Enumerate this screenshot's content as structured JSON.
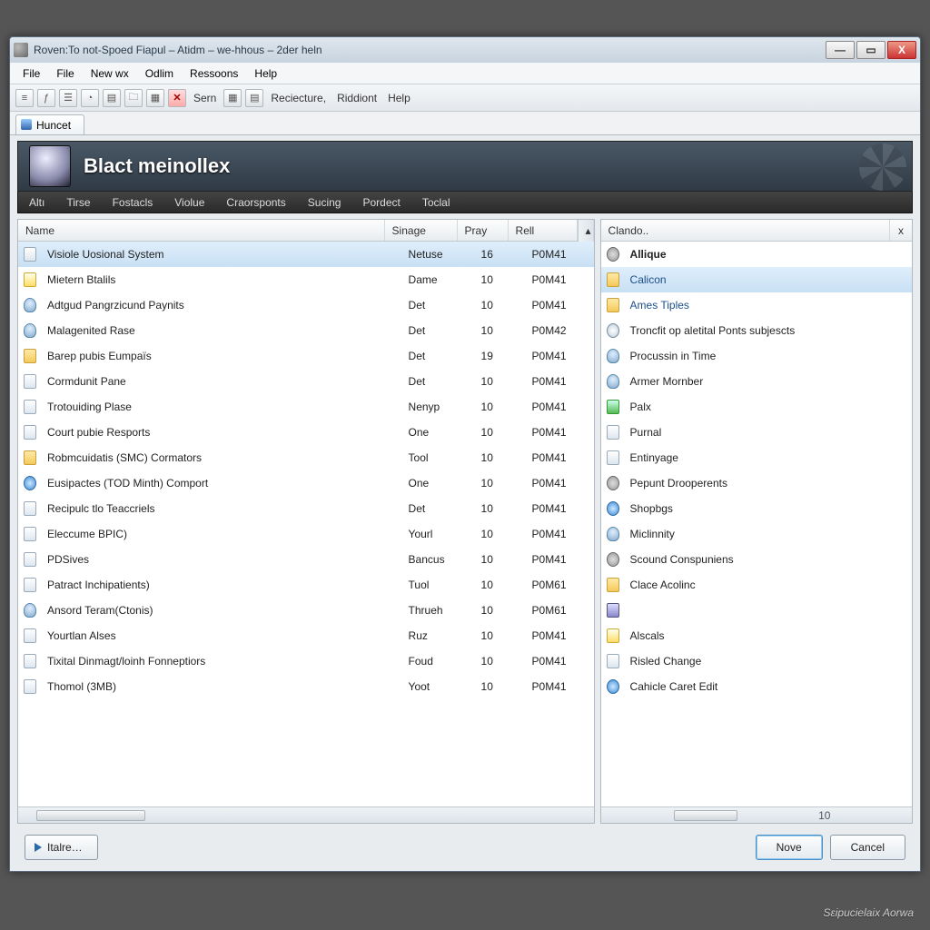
{
  "window": {
    "title": "Roven:To not-Spoed Fiapul – Atidm – we-hhous – 2der heln"
  },
  "menu": [
    "File",
    "File",
    "New wx",
    "Odlim",
    "Ressoons",
    "Help"
  ],
  "toolbar": {
    "sern_label": "Sern",
    "labels": [
      "Reciecture,",
      "Riddiont",
      "Help"
    ]
  },
  "tab": {
    "label": "Huncet"
  },
  "banner": {
    "title": "Blact meinollex"
  },
  "subnav": [
    "Altı",
    "Tirse",
    "Fostacls",
    "Violue",
    "Craorsponts",
    "Sucing",
    "Pordect",
    "Toclal"
  ],
  "left_columns": {
    "name": "Name",
    "sinage": "Sinage",
    "pray": "Pray",
    "rell": "Rell"
  },
  "left_rows": [
    {
      "icon": "page",
      "name": "Visiole Uosional System",
      "sinage": "Netuse",
      "pray": "16",
      "rell": "P0M41",
      "sel": true
    },
    {
      "icon": "warn",
      "name": "Mietern Btalils",
      "sinage": "Dame",
      "pray": "10",
      "rell": "P0M41"
    },
    {
      "icon": "user",
      "name": "Adtgud Pangrzicund Paynits",
      "sinage": "Det",
      "pray": "10",
      "rell": "P0M41"
    },
    {
      "icon": "user",
      "name": "Malagenited Rase",
      "sinage": "Det",
      "pray": "10",
      "rell": "P0M42"
    },
    {
      "icon": "folder",
      "name": "Barep pubis Eumpaïs",
      "sinage": "Det",
      "pray": "19",
      "rell": "P0M41"
    },
    {
      "icon": "page",
      "name": "Cormdunit Pane",
      "sinage": "Det",
      "pray": "10",
      "rell": "P0M41"
    },
    {
      "icon": "page",
      "name": "Trotouiding Plase",
      "sinage": "Nenyp",
      "pray": "10",
      "rell": "P0M41"
    },
    {
      "icon": "page",
      "name": "Court pubie Resports",
      "sinage": "One",
      "pray": "10",
      "rell": "P0M41"
    },
    {
      "icon": "folder",
      "name": "Robmcuidatis (SMC) Cormators",
      "sinage": "Tool",
      "pray": "10",
      "rell": "P0M41"
    },
    {
      "icon": "info",
      "name": "Eusipactes (TOD Minth) Comport",
      "sinage": "One",
      "pray": "10",
      "rell": "P0M41"
    },
    {
      "icon": "page",
      "name": "Recipulc tlo Teaccriels",
      "sinage": "Det",
      "pray": "10",
      "rell": "P0M41"
    },
    {
      "icon": "page",
      "name": "Eleccume BPIC)",
      "sinage": "Yourl",
      "pray": "10",
      "rell": "P0M41"
    },
    {
      "icon": "page",
      "name": "PDSives",
      "sinage": "Bancus",
      "pray": "10",
      "rell": "P0M41"
    },
    {
      "icon": "page",
      "name": "Patract Inchipatients)",
      "sinage": "Tuol",
      "pray": "10",
      "rell": "P0M61"
    },
    {
      "icon": "user",
      "name": "Ansord Teram(Ctonis)",
      "sinage": "Thrueh",
      "pray": "10",
      "rell": "P0M61"
    },
    {
      "icon": "page",
      "name": "Yourtlan Alses",
      "sinage": "Ruz",
      "pray": "10",
      "rell": "P0M41"
    },
    {
      "icon": "page",
      "name": "Tixital Dinmagt/loinh Fonneptiors",
      "sinage": "Foud",
      "pray": "10",
      "rell": "P0M41"
    },
    {
      "icon": "page",
      "name": "Thomol (3MB)",
      "sinage": "Yoot",
      "pray": "10",
      "rell": "P0M41"
    }
  ],
  "right_header": {
    "title": "Clando..",
    "close": "x"
  },
  "right_rows": [
    {
      "icon": "gear",
      "name": "Allique",
      "bold": true
    },
    {
      "icon": "folder",
      "name": "Calicon",
      "link": true,
      "sel": true
    },
    {
      "icon": "folder",
      "name": "Ames Tiples",
      "link": true
    },
    {
      "icon": "clock",
      "name": "Troncfit op aletital Ponts subjescts"
    },
    {
      "icon": "user",
      "name": "Procussin in Time"
    },
    {
      "icon": "user",
      "name": "Armer Mornber"
    },
    {
      "icon": "green",
      "name": "Palx"
    },
    {
      "icon": "page",
      "name": "Purnal"
    },
    {
      "icon": "page",
      "name": "Entinyage"
    },
    {
      "icon": "gear",
      "name": "Pepunt Drooperents"
    },
    {
      "icon": "info",
      "name": "Shopbgs"
    },
    {
      "icon": "user",
      "name": "Miclinnity"
    },
    {
      "icon": "gear",
      "name": "Scound Conspuniens"
    },
    {
      "icon": "folder",
      "name": "Clace Acolinc"
    },
    {
      "icon": "tool",
      "name": ""
    },
    {
      "icon": "warn",
      "name": "Alscals"
    },
    {
      "icon": "page",
      "name": "Risled Change"
    },
    {
      "icon": "info",
      "name": "Cahicle Caret Edit"
    }
  ],
  "hscroll_label": "10",
  "footer": {
    "ltale": "Ιtalre…",
    "nove": "Nove",
    "cancel": "Cancel"
  },
  "watermark": "Sɛipucielaix Aorwa"
}
